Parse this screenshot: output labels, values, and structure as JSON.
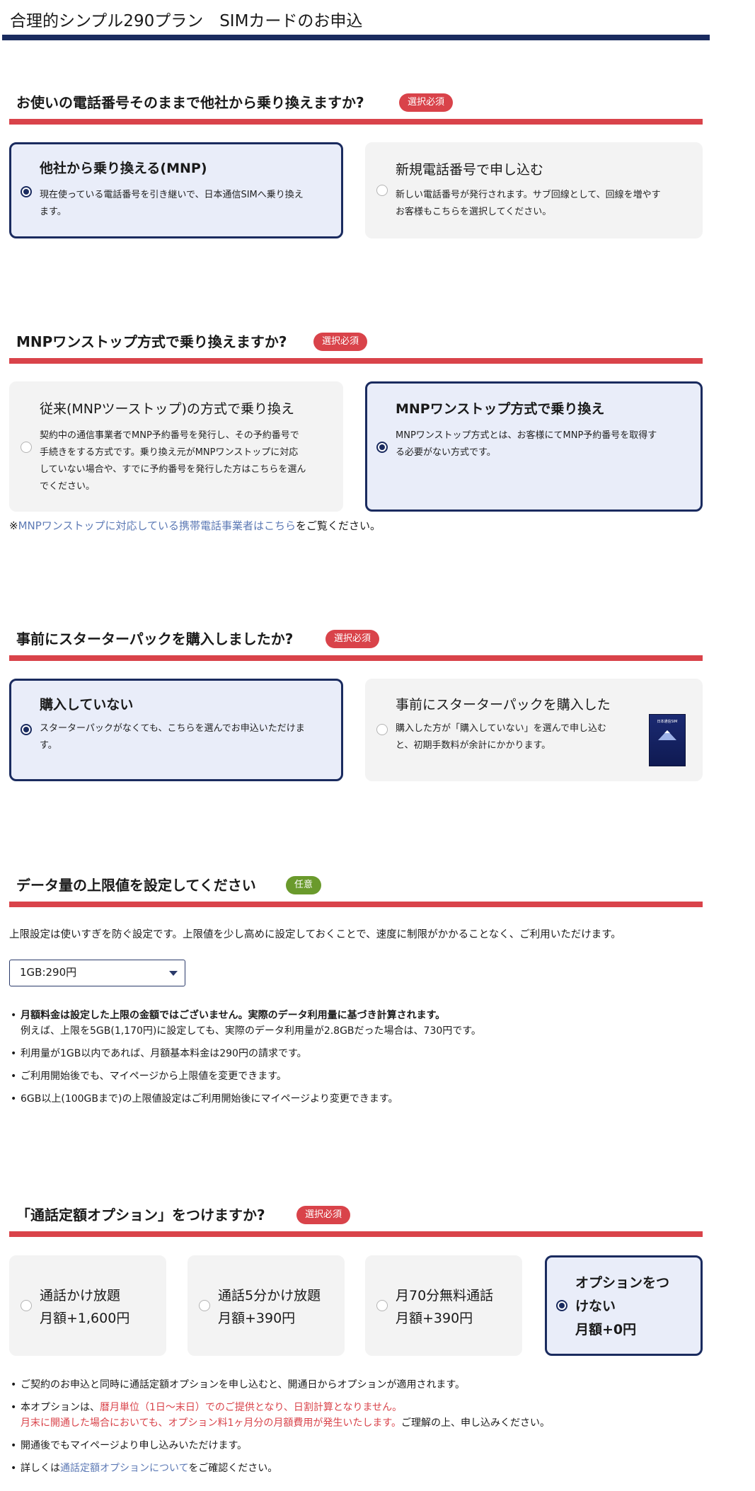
{
  "page": {
    "title": "合理的シンプル290プラン　SIMカードのお申込"
  },
  "q1": {
    "title": "お使いの電話番号そのままで他社から乗り換えますか?",
    "badge": "選択必須",
    "options": [
      {
        "title": "他社から乗り換える(MNP)",
        "desc": [
          "現在使っている電話番号を引き継いで、日本通信SIMへ乗り換え",
          "ます。"
        ],
        "selected": true
      },
      {
        "title": "新規電話番号で申し込む",
        "desc": [
          "新しい電話番号が発行されます。サブ回線として、回線を増やす",
          "お客様もこちらを選択してください。"
        ],
        "selected": false
      }
    ]
  },
  "q2": {
    "title": "MNPワンストップ方式で乗り換えますか?",
    "badge": "選択必須",
    "options": [
      {
        "title": "従来(MNPツーストップ)の方式で乗り換え",
        "desc": [
          "契約中の通信事業者でMNP予約番号を発行し、その予約番号で",
          "手続きをする方式です。乗り換え元がMNPワンストップに対応",
          "していない場合や、すでに予約番号を発行した方はこちらを選ん",
          "でください。"
        ],
        "selected": false
      },
      {
        "title": "MNPワンストップ方式で乗り換え",
        "desc": [
          "MNPワンストップ方式とは、お客様にてMNP予約番号を取得す",
          "る必要がない方式です。"
        ],
        "selected": true
      }
    ],
    "note_prefix": "※",
    "note_link": "MNPワンストップに対応している携帯電話事業者はこちら",
    "note_suffix": "をご覧ください。"
  },
  "q3": {
    "title": "事前にスターターパックを購入しましたか?",
    "badge": "選択必須",
    "options": [
      {
        "title": "購入していない",
        "desc": [
          "スターターパックがなくても、こちらを選んでお申込いただけま",
          "す。"
        ],
        "selected": true
      },
      {
        "title": "事前にスターターパックを購入した",
        "desc": [
          "購入した方が「購入していない」を選んで申し込む",
          "と、初期手数料が余計にかかります。"
        ],
        "selected": false
      }
    ],
    "pack_label": "日本通信SIM"
  },
  "q4": {
    "title": "データ量の上限値を設定してください",
    "badge": "任意",
    "intro": "上限設定は使いすぎを防ぐ設定です。上限値を少し高めに設定しておくことで、速度に制限がかかることなく、ご利用いただけます。",
    "select_value": "1GB:290円",
    "notes_bold": "月額料金は設定した上限の金額ではございません。実際のデータ利用量に基づき計算されます。",
    "notes_bold_sub": "例えば、上限を5GB(1,170円)に設定しても、実際のデータ利用量が2.8GBだった場合は、730円です。",
    "notes": [
      "利用量が1GB以内であれば、月額基本料金は290円の請求です。",
      "ご利用開始後でも、マイページから上限値を変更できます。",
      "6GB以上(100GBまで)の上限値設定はご利用開始後にマイページより変更できます。"
    ]
  },
  "q5": {
    "title": "「通話定額オプション」をつけますか?",
    "badge": "選択必須",
    "options": [
      {
        "line1": "通話かけ放題",
        "line2": "月額+1,600円",
        "selected": false
      },
      {
        "line1": "通話5分かけ放題",
        "line2": "月額+390円",
        "selected": false
      },
      {
        "line1": "月70分無料通話",
        "line2": "月額+390円",
        "selected": false
      },
      {
        "line1": "オプションをつ",
        "line1b": "けない",
        "line2": "月額+0円",
        "selected": true
      }
    ],
    "note1": "ご契約のお申込と同時に通話定額オプションを申し込むと、開通日からオプションが適用されます。",
    "note2_a": "本オプションは、",
    "note2_red": "暦月単位（1日〜末日）でのご提供となり、日割計算となりません。",
    "note2_red2": "月末に開通した場合においても、オプション料1ヶ月分の月額費用が発生いたします。",
    "note2_b": "ご理解の上、申し込みください。",
    "note3": "開通後でもマイページより申し込みいただけます。",
    "note4_a": "詳しくは",
    "note4_link": "通話定額オプションについて",
    "note4_b": "をご確認ください。"
  }
}
